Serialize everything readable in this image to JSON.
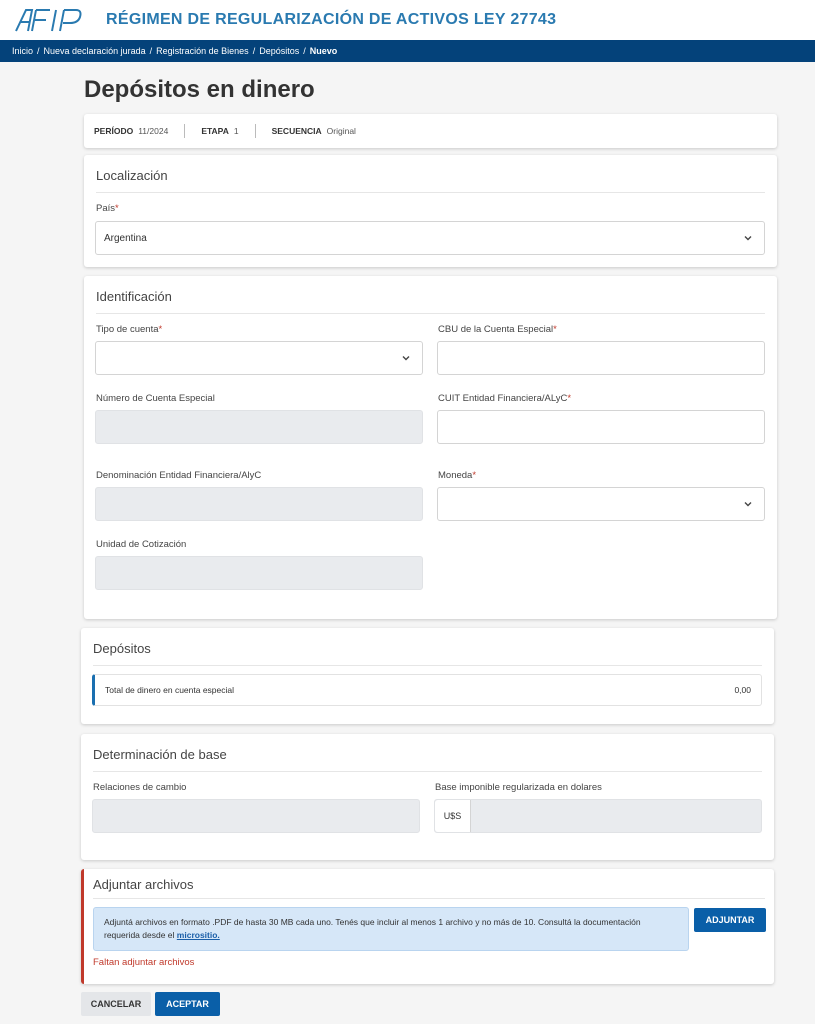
{
  "header": {
    "logo": "AFIP",
    "title": "RÉGIMEN DE REGULARIZACIÓN DE ACTIVOS LEY 27743"
  },
  "breadcrumb": [
    "Inicio",
    "Nueva declaración jurada",
    "Registración de Bienes",
    "Depósitos",
    "Nuevo"
  ],
  "page": {
    "title": "Depósitos en dinero"
  },
  "meta": {
    "periodo_label": "PERÍODO",
    "periodo_value": "11/2024",
    "etapa_label": "ETAPA",
    "etapa_value": "1",
    "secuencia_label": "SECUENCIA",
    "secuencia_value": "Original"
  },
  "localizacion": {
    "title": "Localización",
    "pais_label": "País",
    "pais_value": "Argentina"
  },
  "identificacion": {
    "title": "Identificación",
    "tipo_cuenta_label": "Tipo de cuenta",
    "tipo_cuenta_value": "",
    "cbu_label": "CBU de la Cuenta Especial",
    "cbu_value": "",
    "numero_cuenta_label": "Número de Cuenta Especial",
    "cuit_label": "CUIT Entidad Financiera/ALyC",
    "cuit_value": "",
    "denominacion_label": "Denominación Entidad Financiera/AlyC",
    "moneda_label": "Moneda",
    "moneda_value": "",
    "unidad_label": "Unidad de Cotización"
  },
  "depositos": {
    "title": "Depósitos",
    "total_label": "Total de dinero en cuenta especial",
    "total_value": "0,00"
  },
  "determinacion": {
    "title": "Determinación de base",
    "relaciones_label": "Relaciones de cambio",
    "base_label": "Base imponible regularizada en dolares",
    "currency_prefix": "U$S"
  },
  "adjuntar": {
    "title": "Adjuntar archivos",
    "info_text": "Adjuntá archivos en formato .PDF de hasta 30 MB cada uno. Tenés que incluir al menos 1 archivo y no más de 10. Consultá la documentación requerida desde el",
    "info_link": "micrositio.",
    "button": "ADJUNTAR",
    "error": "Faltan adjuntar archivos"
  },
  "actions": {
    "cancel": "CANCELAR",
    "accept": "ACEPTAR"
  },
  "colors": {
    "brand": "#04427a",
    "accent": "#0a5fa8",
    "error": "#c0392b",
    "title_blue": "#2a7ab0"
  },
  "icons": {
    "logo": "afip-logo",
    "dropdown": "chevron-down-icon"
  }
}
